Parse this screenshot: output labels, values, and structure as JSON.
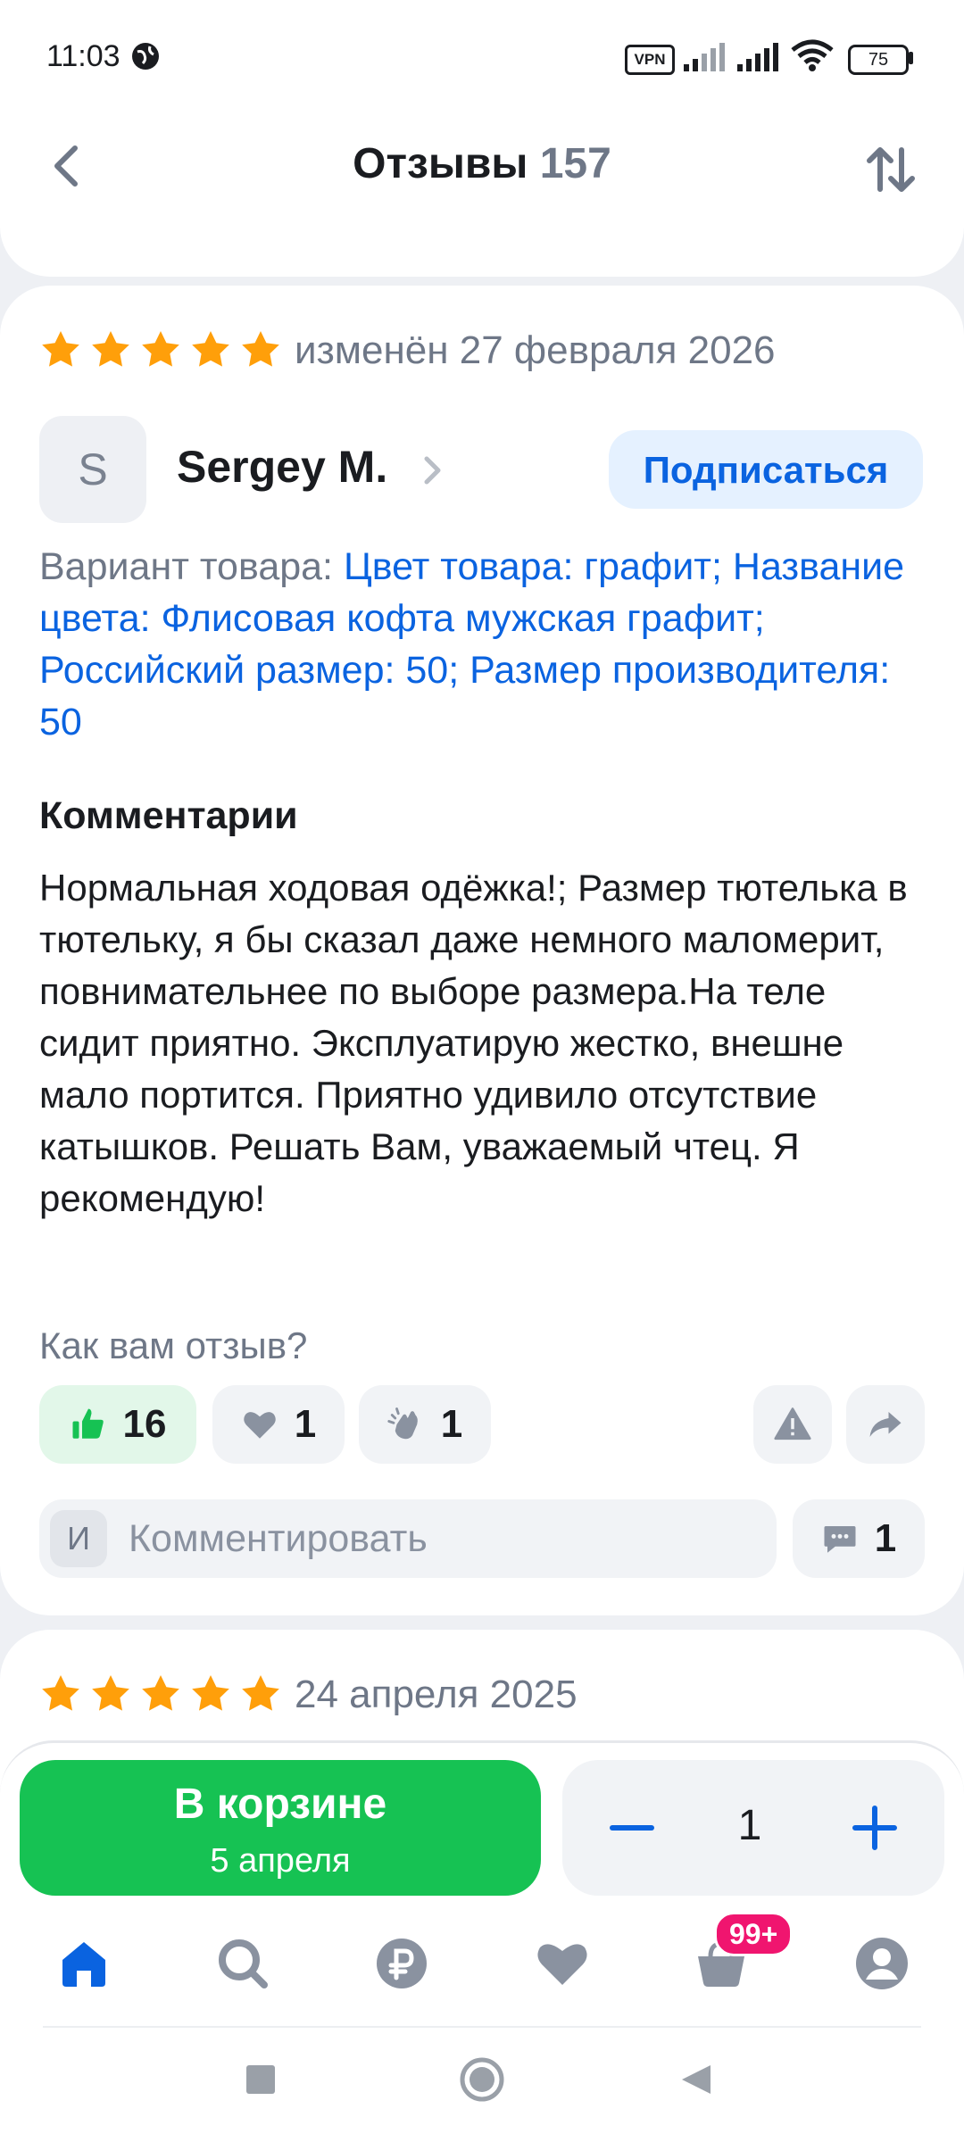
{
  "status_bar": {
    "time": "11:03",
    "vpn_label": "VPN",
    "battery": "75",
    "icons": [
      "globe-icon",
      "vpn-icon",
      "signal-icon",
      "signal-icon",
      "wifi-icon",
      "battery-icon"
    ]
  },
  "header": {
    "title": "Отзывы",
    "count": "157",
    "back_icon": "chevron-left-icon",
    "sort_icon": "sort-icon"
  },
  "review": {
    "rating": 5,
    "date": "изменён 27 февраля 2026",
    "author": {
      "initial": "S",
      "name": "Sergey M."
    },
    "subscribe_label": "Подписаться",
    "variant_label": "Вариант товара:",
    "variant_value": "Цвет товара: графит; Название цвета: Флисовая кофта мужская графит; Российский размер: 50; Размер производителя: 50",
    "comments_heading": "Комментарии",
    "text": "Нормальная ходовая одёжка!; Размер тютелька в тютельку, я бы сказал даже немного маломерит, повнимательнее по выборе размера.На теле сидит приятно. Эксплуатирую жестко, внешне мало портится. Приятно удивило отсутствие катышков. Решать Вам, уважаемый чтец. Я рекомендую!",
    "feedback_question": "Как вам отзыв?",
    "reactions": {
      "likes": "16",
      "hearts": "1",
      "claps": "1"
    },
    "comment_input": {
      "avatar_initial": "И",
      "placeholder": "Комментировать"
    },
    "comments_count": "1"
  },
  "next_review": {
    "rating": 5,
    "date": "24 апреля 2025"
  },
  "purchase": {
    "button_title": "В корзине",
    "button_subtitle": "5 апреля",
    "quantity": "1"
  },
  "tabbar": {
    "items": [
      "home-icon",
      "search-icon",
      "ruble-icon",
      "heart-icon",
      "cart-icon",
      "profile-icon"
    ],
    "cart_badge": "99+"
  },
  "colors": {
    "accent_blue": "#0a63e0",
    "green": "#16c253",
    "star": "#ff9f0a",
    "badge": "#f0156f"
  }
}
